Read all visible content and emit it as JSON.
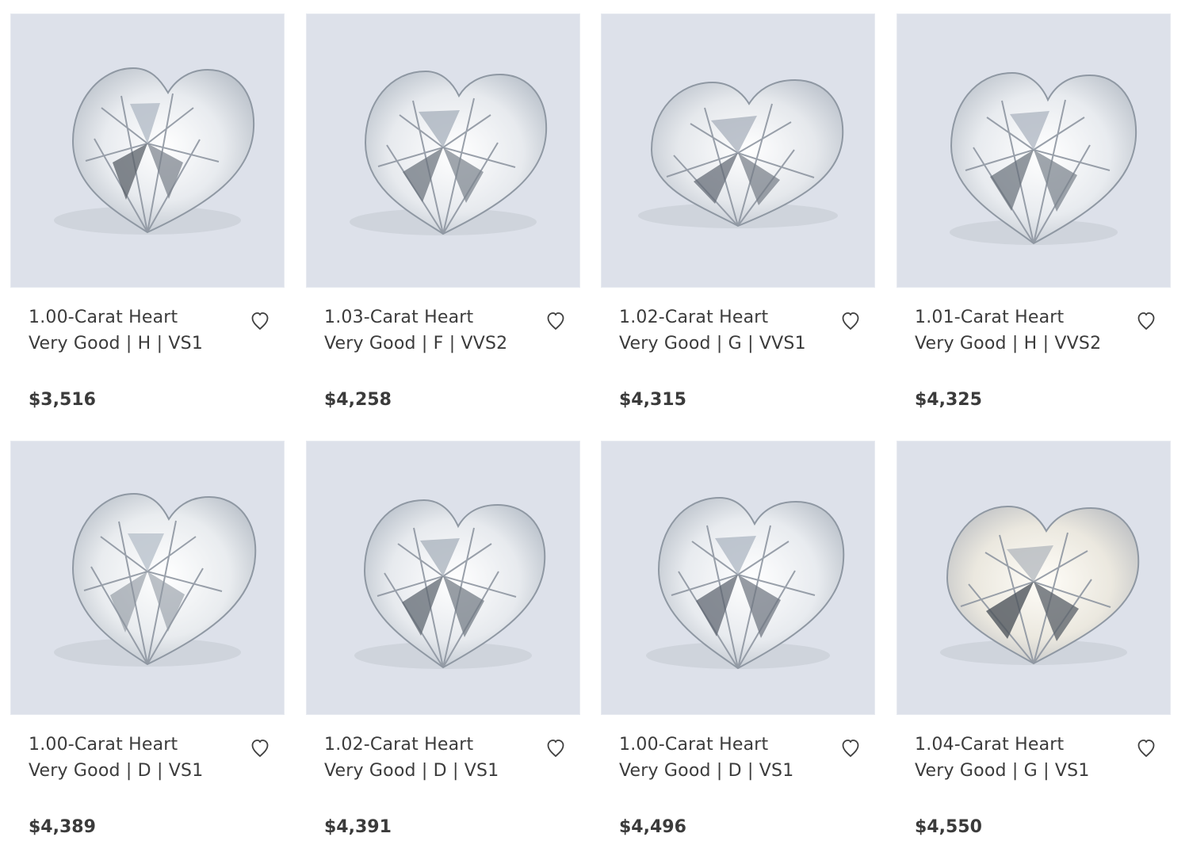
{
  "colors": {
    "image_background": "#dde1ea",
    "text": "#3b3b3b",
    "icon_stroke": "#3f3f3f"
  },
  "products": [
    {
      "title": "1.00-Carat Heart",
      "specs": "Very Good | H | VS1",
      "price": "$3,516",
      "wishlist_icon": "heart-outline-icon"
    },
    {
      "title": "1.03-Carat Heart",
      "specs": "Very Good | F | VVS2",
      "price": "$4,258",
      "wishlist_icon": "heart-outline-icon"
    },
    {
      "title": "1.02-Carat Heart",
      "specs": "Very Good | G | VVS1",
      "price": "$4,315",
      "wishlist_icon": "heart-outline-icon"
    },
    {
      "title": "1.01-Carat Heart",
      "specs": "Very Good | H | VVS2",
      "price": "$4,325",
      "wishlist_icon": "heart-outline-icon"
    },
    {
      "title": "1.00-Carat Heart",
      "specs": "Very Good | D | VS1",
      "price": "$4,389",
      "wishlist_icon": "heart-outline-icon"
    },
    {
      "title": "1.02-Carat Heart",
      "specs": "Very Good | D | VS1",
      "price": "$4,391",
      "wishlist_icon": "heart-outline-icon"
    },
    {
      "title": "1.00-Carat Heart",
      "specs": "Very Good | D | VS1",
      "price": "$4,496",
      "wishlist_icon": "heart-outline-icon"
    },
    {
      "title": "1.04-Carat Heart",
      "specs": "Very Good | G | VS1",
      "price": "$4,550",
      "wishlist_icon": "heart-outline-icon"
    }
  ]
}
